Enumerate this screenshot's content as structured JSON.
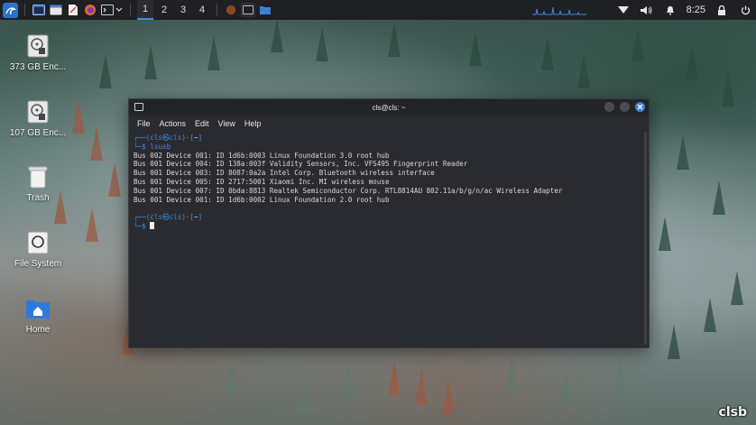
{
  "colors": {
    "accent": "#3f8ae0",
    "panel_bg": "#1f2024",
    "terminal_bg": "#2a2b30"
  },
  "panel": {
    "workspaces": [
      "1",
      "2",
      "3",
      "4"
    ],
    "active_workspace": "1",
    "clock": "8:25",
    "launcher_icons": [
      "kali-menu-icon",
      "terminal-app-icon",
      "files-app-icon",
      "text-editor-icon",
      "firefox-icon",
      "terminal-dropdown-icon"
    ],
    "tray_icons": [
      "network-icon",
      "volume-icon",
      "notification-bell-icon",
      "lock-screen-icon",
      "power-icon"
    ]
  },
  "desktop": {
    "icons": [
      {
        "label": "373 GB Enc...",
        "icon": "drive-icon"
      },
      {
        "label": "107 GB Enc...",
        "icon": "drive-icon"
      },
      {
        "label": "Trash",
        "icon": "trash-icon"
      },
      {
        "label": "File System",
        "icon": "filesystem-icon"
      },
      {
        "label": "Home",
        "icon": "home-folder-icon"
      }
    ]
  },
  "terminal": {
    "title": "cls@cls: ~",
    "menu": [
      "File",
      "Actions",
      "Edit",
      "View",
      "Help"
    ],
    "prompt_open": "┌──(",
    "prompt_user": "cls㉿cls",
    "prompt_mid": ")-[",
    "prompt_dir": "~",
    "prompt_close": "]",
    "prompt_line2": "└─",
    "prompt_symbol": "$",
    "command": "lsusb",
    "output": [
      "Bus 002 Device 001: ID 1d6b:0003 Linux Foundation 3.0 root hub",
      "Bus 001 Device 004: ID 138a:003f Validity Sensors, Inc. VFS495 Fingerprint Reader",
      "Bus 001 Device 003: ID 8087:0a2a Intel Corp. Bluetooth wireless interface",
      "Bus 001 Device 005: ID 2717:5001 Xiaomi Inc. MI wireless mouse",
      "Bus 001 Device 007: ID 0bda:8813 Realtek Semiconductor Corp. RTL8814AU 802.11a/b/g/n/ac Wireless Adapter",
      "Bus 001 Device 001: ID 1d6b:0002 Linux Foundation 2.0 root hub"
    ]
  },
  "watermark": "clsb"
}
